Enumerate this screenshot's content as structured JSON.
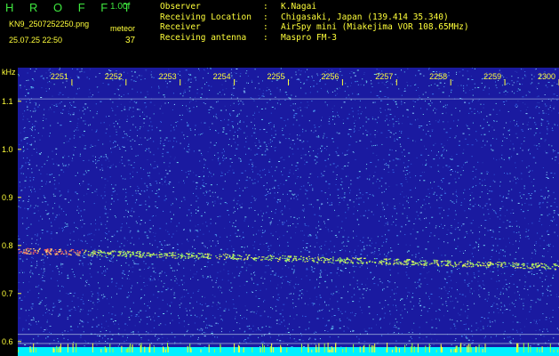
{
  "header": {
    "logo": "H R O F F T",
    "version": "1.00f",
    "filename": "KN9_2507252250.png",
    "meteor_label": "meteor",
    "datetime": "25.07.25 22:50",
    "meteor_count": "37"
  },
  "info": [
    {
      "key": "Observer",
      "sep": ":",
      "value": "K.Nagai"
    },
    {
      "key": "Receiving Location",
      "sep": ":",
      "value": "Chigasaki, Japan (139.414 35.340)"
    },
    {
      "key": "Receiver",
      "sep": ":",
      "value": "AirSpy mini (Miakejima VOR 108.65MHz)"
    },
    {
      "key": "Receiving antenna",
      "sep": ":",
      "value": "Maspro FM-3"
    }
  ],
  "colors": {
    "background": "#1a1aa0",
    "text": "#ffff3a",
    "logo": "#3ee73e",
    "baseline": "#00f0ff"
  },
  "chart_data": {
    "type": "heatmap",
    "ylabel": "kHz",
    "y_ticks": [
      {
        "value": 1.1,
        "label": "1.1"
      },
      {
        "value": 1.0,
        "label": "1.0"
      },
      {
        "value": 0.9,
        "label": "0.9"
      },
      {
        "value": 0.8,
        "label": "0.8"
      },
      {
        "value": 0.7,
        "label": "0.7"
      },
      {
        "value": 0.6,
        "label": "0.6"
      }
    ],
    "x_ticks": [
      {
        "value": 2251,
        "label": "2251"
      },
      {
        "value": 2252,
        "label": "2252"
      },
      {
        "value": 2253,
        "label": "2253"
      },
      {
        "value": 2254,
        "label": "2254"
      },
      {
        "value": 2255,
        "label": "2255"
      },
      {
        "value": 2256,
        "label": "2256"
      },
      {
        "value": 2257,
        "label": "2257"
      },
      {
        "value": 2258,
        "label": "2258"
      },
      {
        "value": 2259,
        "label": "2259"
      },
      {
        "value": 2300,
        "label": "2300"
      }
    ],
    "xlim": [
      2250,
      2300
    ],
    "ylim": [
      0.57,
      1.17
    ],
    "carrier_trace": [
      {
        "x": 2250,
        "y": 0.79
      },
      {
        "x": 2300,
        "y": 0.757
      }
    ],
    "horizontal_lines_khz": [
      1.105,
      0.615,
      0.596
    ]
  }
}
